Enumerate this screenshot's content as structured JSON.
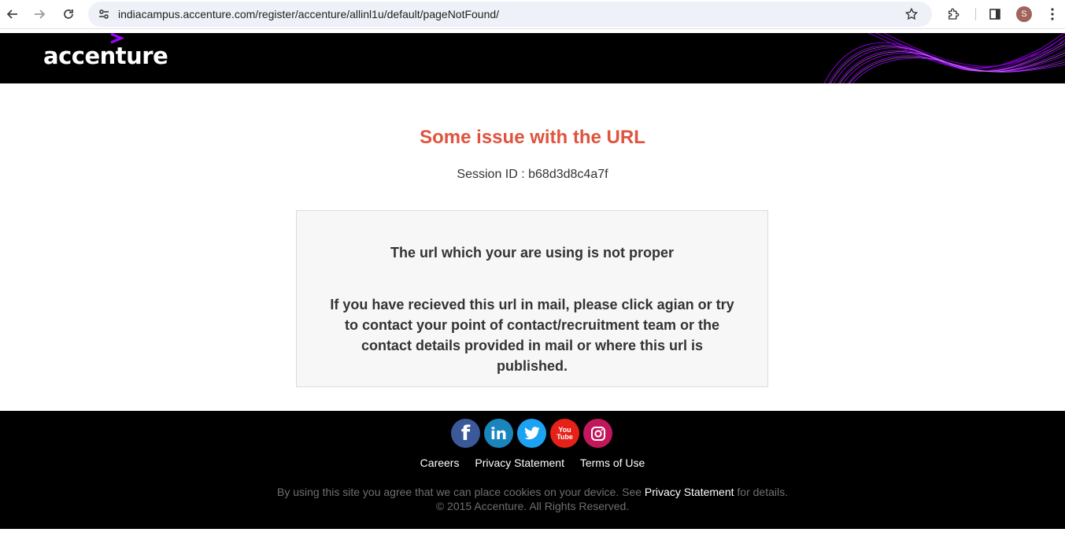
{
  "browser": {
    "url": "indiacampus.accenture.com/register/accenture/allinl1u/default/pageNotFound/",
    "profile_initial": "S"
  },
  "header": {
    "logo_text": "accenture",
    "logo_mark": ">",
    "accent_color": "#a100ff"
  },
  "main": {
    "title": "Some issue with the URL",
    "session_id": "Session ID : b68d3d8c4a7f",
    "message_heading": "The url which your are using is not proper",
    "message_body": "If you have recieved this url in mail, please click agian or try to contact your point of contact/recruitment team or the contact details provided in mail or where this url is published."
  },
  "footer": {
    "social": [
      {
        "name": "facebook-icon",
        "glyph": "f"
      },
      {
        "name": "linkedin-icon",
        "glyph": "in"
      },
      {
        "name": "twitter-icon",
        "glyph": ""
      },
      {
        "name": "youtube-icon",
        "glyph_line1": "You",
        "glyph_line2": "Tube"
      },
      {
        "name": "instagram-icon",
        "glyph": ""
      }
    ],
    "links": [
      "Careers",
      "Privacy Statement",
      "Terms of Use"
    ],
    "cookie_before": "By using this site you agree that we can place cookies on your device. See ",
    "cookie_link": "Privacy Statement",
    "cookie_after": " for details.",
    "copyright": "© 2015 Accenture. All Rights Reserved."
  },
  "colors": {
    "title_red": "#e0533f",
    "header_bg": "#000000"
  }
}
